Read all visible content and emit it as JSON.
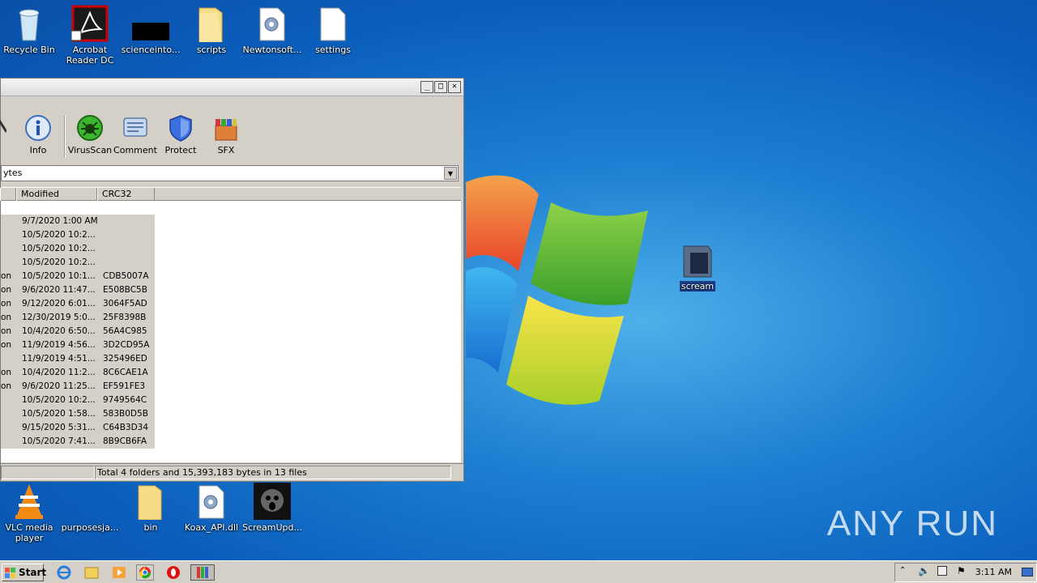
{
  "desktop_icons_top": [
    {
      "label": "Recycle Bin"
    },
    {
      "label": "Acrobat Reader DC"
    },
    {
      "label": "scienceinto..."
    },
    {
      "label": "scripts"
    },
    {
      "label": "Newtonsoft..."
    },
    {
      "label": "settings"
    }
  ],
  "desktop_icons_bottom": [
    {
      "label": "VLC media player"
    },
    {
      "label": "purposesja..."
    },
    {
      "label": "bin"
    },
    {
      "label": "Koax_API.dll"
    },
    {
      "label": "ScreamUpd..."
    }
  ],
  "scream_icon": {
    "label": "scream"
  },
  "watermark": "ANY RUN",
  "winrar": {
    "toolbar": [
      {
        "label": "rd",
        "icon": "wizard-icon"
      },
      {
        "label": "Info",
        "icon": "info-icon"
      },
      {
        "label": "VirusScan",
        "icon": "virusscan-icon"
      },
      {
        "label": "Comment",
        "icon": "comment-icon"
      },
      {
        "label": "Protect",
        "icon": "shield-icon"
      },
      {
        "label": "SFX",
        "icon": "sfx-icon"
      }
    ],
    "address_text": "ytes",
    "columns": {
      "modified": "Modified",
      "crc": "CRC32"
    },
    "rows": [
      {
        "prefix": "",
        "modified": "9/7/2020 1:00 AM",
        "crc": ""
      },
      {
        "prefix": "",
        "modified": "10/5/2020 10:2...",
        "crc": ""
      },
      {
        "prefix": "",
        "modified": "10/5/2020 10:2...",
        "crc": ""
      },
      {
        "prefix": "",
        "modified": "10/5/2020 10:2...",
        "crc": ""
      },
      {
        "prefix": "on",
        "modified": "10/5/2020 10:1...",
        "crc": "CDB5007A"
      },
      {
        "prefix": "on",
        "modified": "9/6/2020 11:47...",
        "crc": "E508BC5B"
      },
      {
        "prefix": "on",
        "modified": "9/12/2020 6:01...",
        "crc": "3064F5AD"
      },
      {
        "prefix": "on",
        "modified": "12/30/2019 5:0...",
        "crc": "25F8398B"
      },
      {
        "prefix": "on",
        "modified": "10/4/2020 6:50...",
        "crc": "56A4C985"
      },
      {
        "prefix": "on",
        "modified": "11/9/2019 4:56...",
        "crc": "3D2CD95A"
      },
      {
        "prefix": "",
        "modified": "11/9/2019 4:51...",
        "crc": "325496ED"
      },
      {
        "prefix": "on",
        "modified": "10/4/2020 11:2...",
        "crc": "8C6CAE1A"
      },
      {
        "prefix": "on",
        "modified": "9/6/2020 11:25...",
        "crc": "EF591FE3"
      },
      {
        "prefix": "",
        "modified": "10/5/2020 10:2...",
        "crc": "9749564C"
      },
      {
        "prefix": "",
        "modified": "10/5/2020 1:58...",
        "crc": "583B0D5B"
      },
      {
        "prefix": "",
        "modified": "9/15/2020 5:31...",
        "crc": "C64B3D34"
      },
      {
        "prefix": "",
        "modified": "10/5/2020 7:41...",
        "crc": "8B9CB6FA"
      }
    ],
    "status": "Total 4 folders and 15,393,183 bytes in 13 files"
  },
  "taskbar": {
    "start_label": "Start",
    "clock": "3:11 AM"
  }
}
